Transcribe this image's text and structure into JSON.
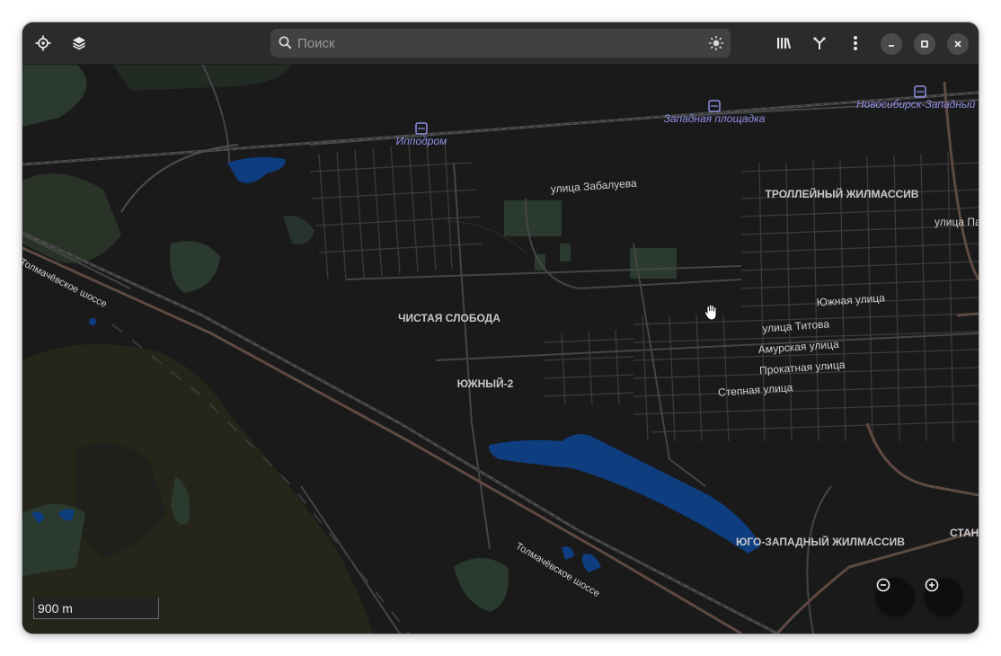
{
  "search": {
    "placeholder": "Поиск"
  },
  "map": {
    "districts": [
      "ТРОЛЛЕЙНЫЙ ЖИЛМАССИВ",
      "ЧИСТАЯ СЛОБОДА",
      "ЮЖНЫЙ-2",
      "ЮГО-ЗАПАДНЫЙ ЖИЛМАССИВ",
      "СТАН"
    ],
    "stations": [
      "Ипподром",
      "Западная площадка",
      "Новосибирск-Западный"
    ],
    "streets": [
      "улица Забалуева",
      "Южная улица",
      "улица Титова",
      "Амурская улица",
      "Прокатная улица",
      "Степная улица",
      "улица Па",
      "Толмачёвское шоссе",
      "Толмачёвское шоссе"
    ]
  },
  "scale": {
    "label": "900 m"
  },
  "colors": {
    "background": "#1a1a1b",
    "header": "#2b2b2d",
    "water": "#0e3d80",
    "park": "#2b3a2f",
    "station_label": "#8f8fe6",
    "highway": "#5e4a40"
  }
}
